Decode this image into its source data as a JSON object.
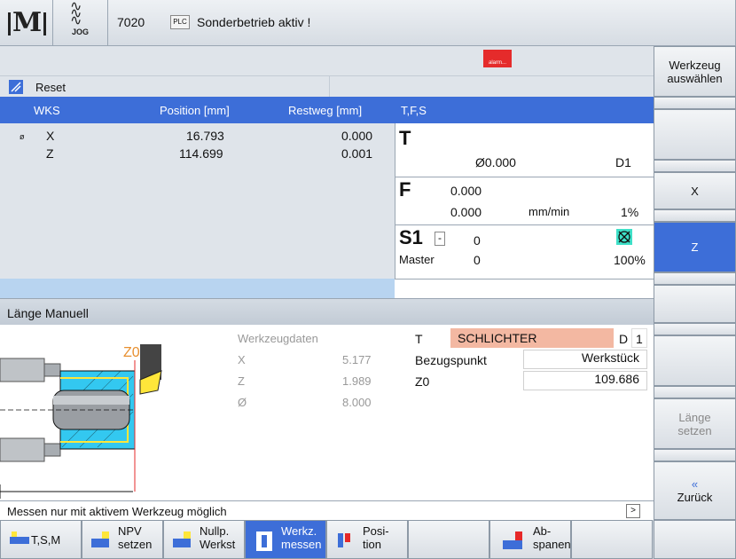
{
  "topbar": {
    "logo": "M",
    "mode_icon": "jog-wave-icon",
    "mode_label": "JOG",
    "program": "7020",
    "plc_label": "PLC",
    "message": "Sonderbetrieb aktiv !"
  },
  "alarm": {
    "label": "alarm..."
  },
  "status": {
    "reset_label": "Reset"
  },
  "position_table": {
    "headers": [
      "WKS",
      "Position [mm]",
      "Restweg [mm]",
      "T,F,S"
    ],
    "rows": [
      {
        "diam": "ø",
        "axis": "X",
        "position": "16.793",
        "restweg": "0.000"
      },
      {
        "diam": "",
        "axis": "Z",
        "position": "114.699",
        "restweg": "0.001"
      }
    ]
  },
  "tfs": {
    "t_label": "T",
    "t_diam": "Ø0.000",
    "t_d": "D1",
    "f_label": "F",
    "f_value": "0.000",
    "f_value2": "0.000",
    "f_unit": "mm/min",
    "f_percent": "1%",
    "s_label": "S1",
    "s_dropdown": "-",
    "s_value": "0",
    "s_master_label": "Master",
    "s_master_value": "0",
    "s_percent": "100%"
  },
  "laenge": {
    "title": "Länge Manuell",
    "z0_label": "Z0",
    "werkzeugdaten_title": "Werkzeugdaten",
    "werkzeugdaten": [
      {
        "label": "X",
        "value": "5.177"
      },
      {
        "label": "Z",
        "value": "1.989"
      },
      {
        "label": "Ø",
        "value": "8.000"
      }
    ],
    "t_label": "T",
    "t_value": "SCHLICHTER",
    "d_label": "D",
    "d_value": "1",
    "bezug_label": "Bezugspunkt",
    "bezug_value": "Werkstück",
    "z0_field_label": "Z0",
    "z0_value": "109.686"
  },
  "info": {
    "message": "Messen nur mit aktivem Werkzeug möglich",
    "arrow": ">"
  },
  "right_softkeys": [
    {
      "line1": "Werkzeug",
      "line2": "auswählen"
    },
    {
      "line1": "",
      "line2": ""
    },
    {
      "line1": "",
      "line2": ""
    },
    {
      "line1": "X",
      "line2": ""
    },
    {
      "line1": "Z",
      "line2": ""
    },
    {
      "line1": "",
      "line2": ""
    },
    {
      "line1": "",
      "line2": ""
    },
    {
      "line1": "Länge",
      "line2": "setzen"
    },
    {
      "line1": "«",
      "line2": "Zurück"
    }
  ],
  "bottom_softkeys": [
    {
      "line1": "T,S,M",
      "line2": ""
    },
    {
      "line1": "NPV",
      "line2": "setzen",
      "sub": "ZØ"
    },
    {
      "line1": "Nullp.",
      "line2": "Werkst",
      "sub": "ø"
    },
    {
      "line1": "Werkz.",
      "line2": "messen"
    },
    {
      "line1": "Posi-",
      "line2": "tion"
    },
    {
      "line1": "",
      "line2": ""
    },
    {
      "line1": "Ab-",
      "line2": "spanen"
    },
    {
      "line1": "",
      "line2": ""
    }
  ],
  "colors": {
    "accent": "#3d6ed8",
    "alarm_red": "#e52b2b",
    "highlight_field": "#f3b8a2",
    "tool_yellow": "#ffe63a",
    "workpiece_cyan": "#33c8f0"
  }
}
